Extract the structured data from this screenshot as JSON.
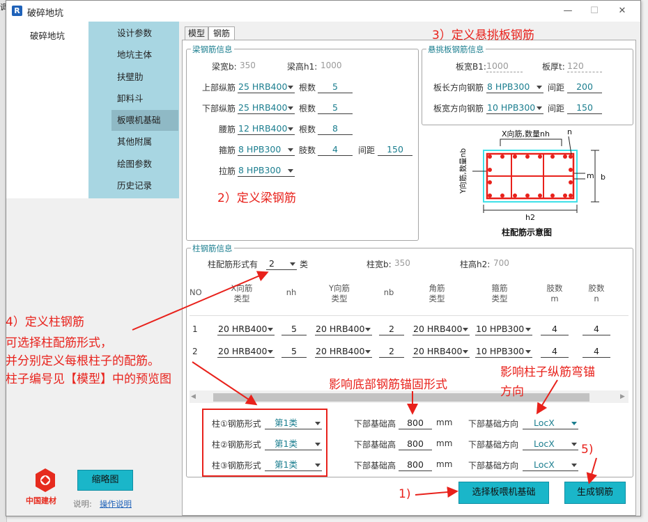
{
  "window": {
    "title": "破碎地坑",
    "app_icon": "R",
    "min": "—",
    "max": "☐",
    "close": "✕"
  },
  "nav": {
    "header": "破碎地坑",
    "items": [
      "设计参数",
      "地坑主体",
      "扶壁肋",
      "卸料斗",
      "板喂机基础",
      "其他附属",
      "绘图参数",
      "历史记录"
    ],
    "active": 4
  },
  "tabs": [
    "模型",
    "钢筋"
  ],
  "active_tab": 1,
  "beam": {
    "title": "梁钢筋信息",
    "width_label": "梁宽b:",
    "width": "350",
    "height_label": "梁高h1:",
    "height": "1000",
    "top_label": "上部纵筋",
    "top_bar": "25 HRB400",
    "top_count_label": "根数",
    "top_count": "5",
    "bottom_label": "下部纵筋",
    "bottom_bar": "25 HRB400",
    "bottom_count_label": "根数",
    "bottom_count": "5",
    "waist_label": "腰筋",
    "waist_bar": "12 HRB400",
    "waist_count_label": "根数",
    "waist_count": "8",
    "stirrup_label": "箍筋",
    "stirrup_bar": "8 HPB300",
    "legs_label": "肢数",
    "legs": "4",
    "spacing_label": "间距",
    "spacing": "150",
    "tie_label": "拉筋",
    "tie_bar": "8 HPB300"
  },
  "cantilever": {
    "title": "悬挑板钢筋信息",
    "width_label": "板宽B1:",
    "width": "1000",
    "thick_label": "板厚t:",
    "thick": "120",
    "long_label": "板长方向钢筋",
    "long_bar": "8 HPB300",
    "long_sp_label": "间距",
    "long_sp": "200",
    "wide_label": "板宽方向钢筋",
    "wide_bar": "10 HPB300",
    "wide_sp_label": "间距",
    "wide_sp": "150"
  },
  "diagram": {
    "top_label": "X向筋,数量nh",
    "n": "n",
    "m": "m",
    "b": "b",
    "y_label": "Y向筋,数量nb",
    "h2": "h2",
    "caption": "柱配筋示意图"
  },
  "column": {
    "title": "柱钢筋信息",
    "types_label": "柱配筋形式有",
    "types": "2",
    "types_unit": "类",
    "width_label": "柱宽b:",
    "width": "350",
    "height_label": "柱高h2:",
    "height": "700",
    "headers": [
      [
        "NO",
        ""
      ],
      [
        "X向筋",
        "类型"
      ],
      [
        "nh",
        ""
      ],
      [
        "Y向筋",
        "类型"
      ],
      [
        "nb",
        ""
      ],
      [
        "角筋",
        "类型"
      ],
      [
        "箍筋",
        "类型"
      ],
      [
        "肢数",
        "m"
      ],
      [
        "胶数",
        "n"
      ]
    ],
    "rows": [
      {
        "no": "1",
        "x": "20 HRB400",
        "nh": "5",
        "y": "20 HRB400",
        "nb": "2",
        "corner": "20 HRB400",
        "stirrup": "10 HPB300",
        "m": "4",
        "n": "4"
      },
      {
        "no": "2",
        "x": "20 HRB400",
        "nh": "5",
        "y": "20 HRB400",
        "nb": "2",
        "corner": "20 HRB400",
        "stirrup": "10 HPB300",
        "m": "4",
        "n": "4"
      }
    ],
    "assign": [
      {
        "label": "柱①钢筋形式",
        "form": "第1类",
        "h_label": "下部基础高",
        "h": "800",
        "unit": "mm",
        "dir_label": "下部基础方向",
        "dir": "LocX"
      },
      {
        "label": "柱②钢筋形式",
        "form": "第1类",
        "h_label": "下部基础高",
        "h": "800",
        "unit": "mm",
        "dir_label": "下部基础方向",
        "dir": "LocX"
      },
      {
        "label": "柱③钢筋形式",
        "form": "第1类",
        "h_label": "下部基础高",
        "h": "800",
        "unit": "mm",
        "dir_label": "下部基础方向",
        "dir": "LocX"
      }
    ]
  },
  "annotations": {
    "a1": "1)",
    "a2": "2）定义梁钢筋",
    "a3": "3）定义悬挑板钢筋",
    "a4_1": "4）定义柱钢筋",
    "a4_2": "可选择柱配筋形式，",
    "a4_3": "并分别定义每根柱子的配筋。",
    "a4_4": "柱子编号见【模型】中的预览图",
    "a5": "5)",
    "base_anchor": "影响底部钢筋锚固形式",
    "bend_1": "影响柱子纵筋弯锚",
    "bend_2": "方向"
  },
  "buttons": {
    "thumbnail": "缩略图",
    "select_base": "选择板喂机基础",
    "generate": "生成钢筋"
  },
  "footer": {
    "logo_text": "中国建材",
    "note_label": "说明:",
    "note_link": "操作说明"
  },
  "colors": {
    "accent": "#1ab6c9",
    "nav_bg": "#a8d6e2",
    "annotation": "#e8211b",
    "logo": "#e62b1e"
  },
  "back_left_text": "调"
}
